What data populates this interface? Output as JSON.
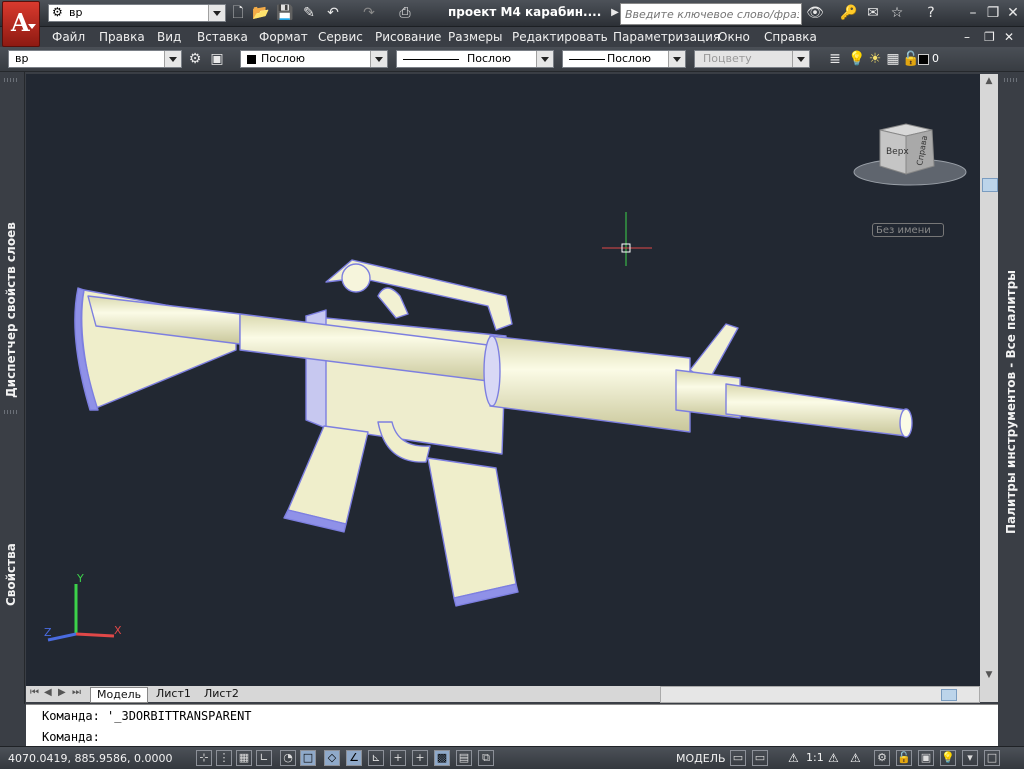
{
  "titlebar": {
    "workspace_value": "вр",
    "document_title": "проект M4 карабин....",
    "search_placeholder": "Введите ключевое слово/фразу"
  },
  "menu": {
    "items": [
      "Файл",
      "Правка",
      "Вид",
      "Вставка",
      "Формат",
      "Сервис",
      "Рисование",
      "Размеры",
      "Редактировать",
      "Параметризация",
      "Окно",
      "Справка"
    ]
  },
  "properties_bar": {
    "layer_value": "вр",
    "color_value": "Послою",
    "linetype_value": "Послою",
    "lineweight_value": "Послою",
    "plotstyle_value": "Поцвету",
    "layer_count": "0"
  },
  "panels": {
    "left_top": "Диспетчер свойств слоев",
    "left_bottom": "Свойства",
    "right": "Палитры инструментов - Все палитры"
  },
  "viewport": {
    "viewcube_top": "Верх",
    "viewcube_right": "Справа",
    "named_view": "Без имени",
    "ucs_x": "X",
    "ucs_y": "Y",
    "ucs_z": "Z",
    "model_color": "#f2f0c8",
    "edge_color": "#7d7fe0",
    "background": "#222832"
  },
  "tabs": [
    "Модель",
    "Лист1",
    "Лист2"
  ],
  "command": {
    "line1": "Команда: '_3DORBITTRANSPARENT",
    "line2": "Команда:"
  },
  "status": {
    "coordinates": "4070.0419, 885.9586, 0.0000",
    "space": "МОДЕЛЬ",
    "scale": "1:1"
  }
}
